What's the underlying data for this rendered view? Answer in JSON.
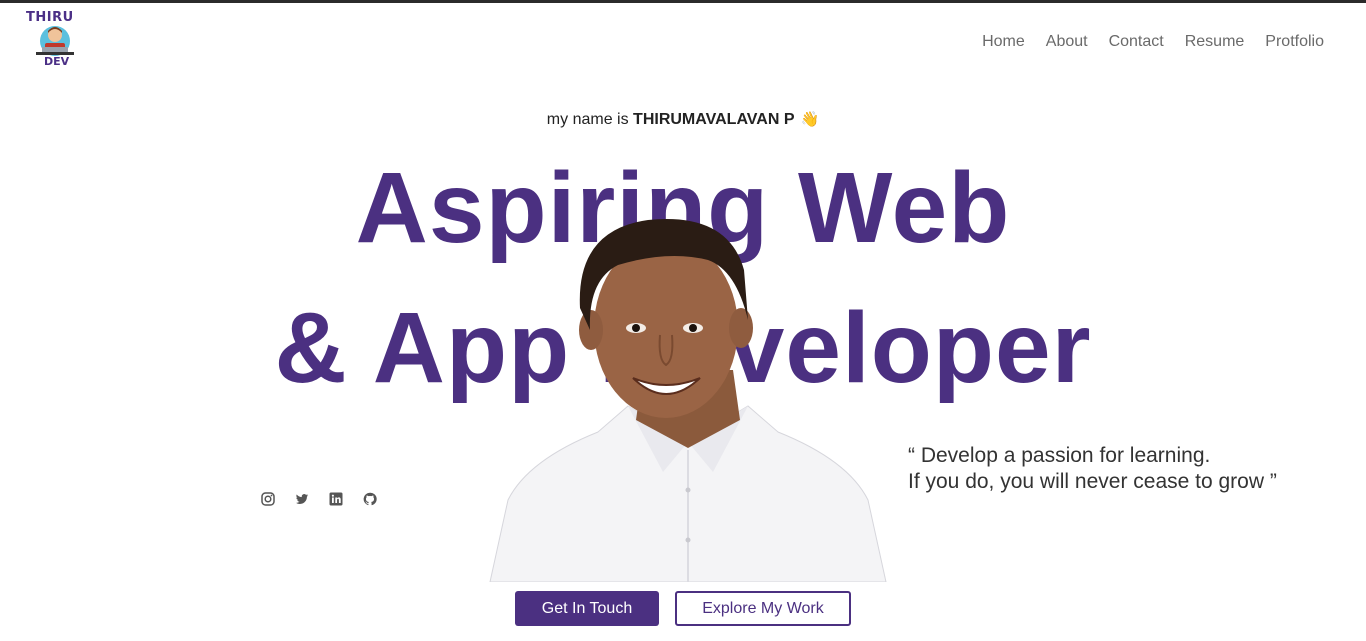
{
  "logo": {
    "top_text": "THIRU",
    "bottom_text": "DEV"
  },
  "nav": {
    "items": [
      "Home",
      "About",
      "Contact",
      "Resume",
      "Protfolio"
    ]
  },
  "hero": {
    "intro_prefix": "my name is ",
    "intro_name": "THIRUMAVALAVAN P",
    "wave_emoji": "👋",
    "headline_line1": "Aspiring Web",
    "headline_line2": "& App Developer",
    "quote_line1": "“ Develop a passion for learning.",
    "quote_line2": "If you do, you will never cease to grow ”"
  },
  "social": {
    "icons": [
      "instagram-icon",
      "twitter-icon",
      "linkedin-icon",
      "github-icon"
    ]
  },
  "buttons": {
    "get_in_touch": "Get In Touch",
    "explore_work": "Explore My Work"
  },
  "colors": {
    "accent": "#4b3081",
    "nav_text": "#6a6a6a",
    "social_icon": "#555555"
  }
}
